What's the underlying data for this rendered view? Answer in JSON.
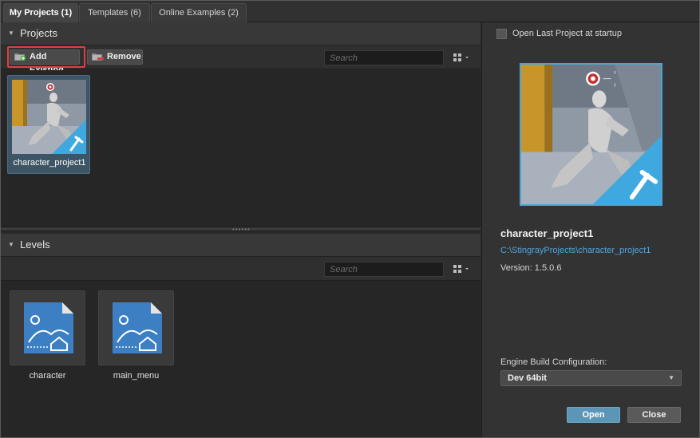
{
  "tabs": [
    {
      "label": "My Projects (1)"
    },
    {
      "label": "Templates (6)"
    },
    {
      "label": "Online Examples (2)"
    }
  ],
  "projects_section": {
    "title": "Projects",
    "add_existing_label": "Add Existing",
    "remove_label": "Remove",
    "search_placeholder": "Search",
    "items": [
      {
        "name": "character_project1"
      }
    ]
  },
  "levels_section": {
    "title": "Levels",
    "search_placeholder": "Search",
    "items": [
      {
        "name": "character"
      },
      {
        "name": "main_menu"
      }
    ]
  },
  "details": {
    "open_last_label": "Open Last Project at startup",
    "open_last_checked": false,
    "project_name": "character_project1",
    "project_path": "C:\\StingrayProjects\\character_project1",
    "version": "Version: 1.5.0.6",
    "engine_label": "Engine Build Configuration:",
    "engine_value": "Dev 64bit",
    "open_label": "Open",
    "close_label": "Close"
  },
  "colors": {
    "accent_blue": "#4aa4d8",
    "highlight_red": "#e04040",
    "open_button": "#5b96b6"
  }
}
